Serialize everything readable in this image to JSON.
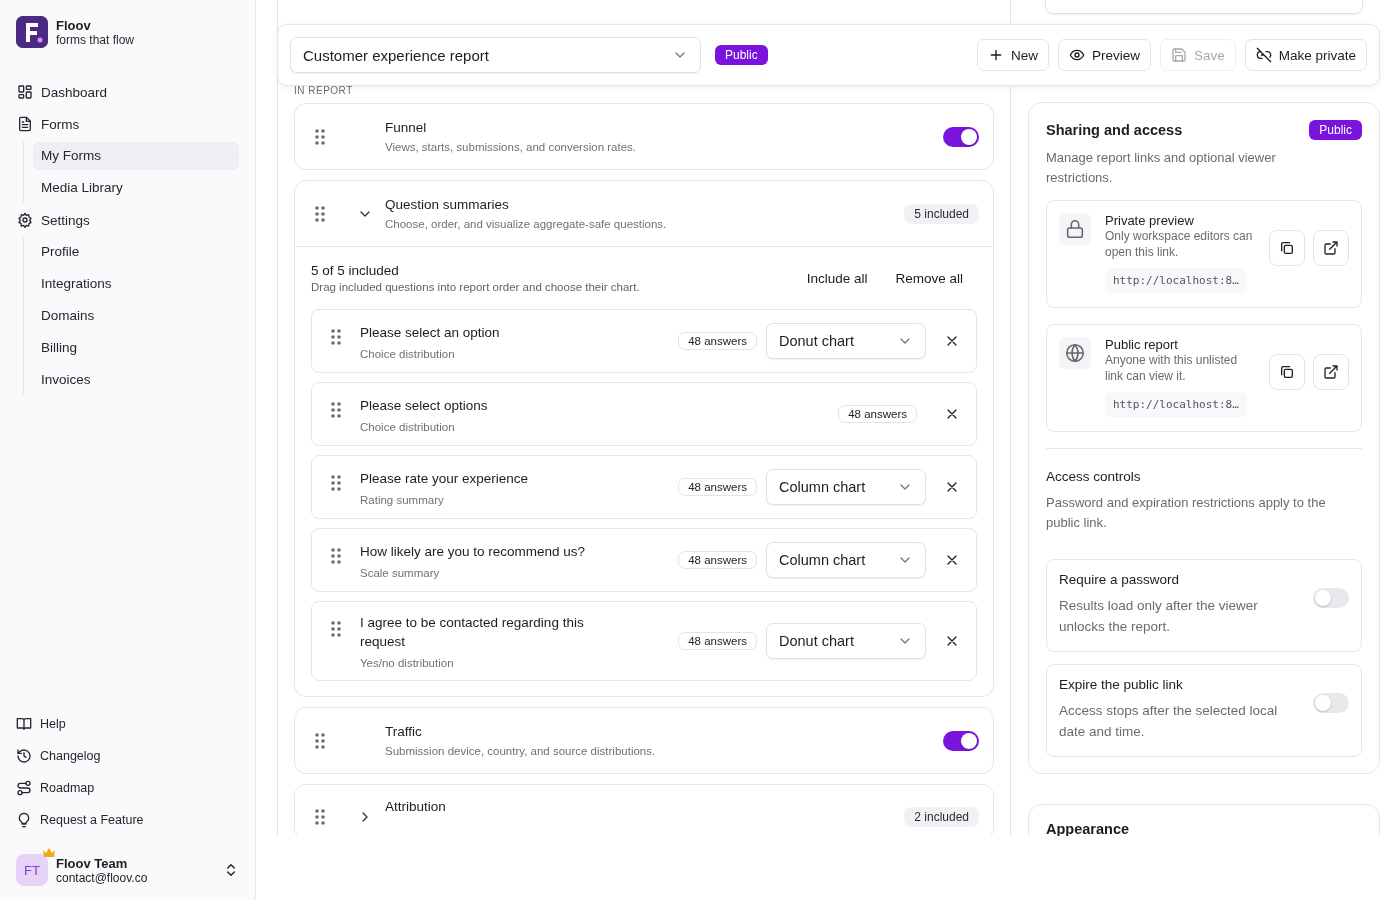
{
  "sidebar": {
    "brand": {
      "name": "Floov",
      "tagline": "forms that flow"
    },
    "nav": [
      {
        "label": "Dashboard",
        "selected": false
      },
      {
        "label": "Forms",
        "selected": false,
        "children": [
          {
            "label": "My Forms",
            "selected": true
          },
          {
            "label": "Media Library",
            "selected": false
          }
        ]
      },
      {
        "label": "Settings",
        "selected": false,
        "children": [
          {
            "label": "Profile",
            "selected": false
          },
          {
            "label": "Integrations",
            "selected": false
          },
          {
            "label": "Domains",
            "selected": false
          },
          {
            "label": "Billing",
            "selected": false
          },
          {
            "label": "Invoices",
            "selected": false
          }
        ]
      }
    ],
    "footer_links": [
      "Help",
      "Changelog",
      "Roadmap",
      "Request a Feature"
    ],
    "user": {
      "initials": "FT",
      "name": "Floov Team",
      "email": "contact@floov.co"
    }
  },
  "toolbar": {
    "report_select": "Customer experience report",
    "visibility_badge": "Public",
    "buttons": [
      {
        "label": "New",
        "disabled": false
      },
      {
        "label": "Preview",
        "disabled": false
      },
      {
        "label": "Save",
        "disabled": true
      },
      {
        "label": "Make private",
        "disabled": false
      }
    ]
  },
  "report": {
    "label": "IN REPORT",
    "sections": [
      {
        "kind": "toggle",
        "title": "Funnel",
        "description": "Views, starts, submissions, and conversion rates.",
        "on": true
      },
      {
        "kind": "group",
        "title": "Question summaries",
        "description": "Choose, order, and visualize aggregate-safe questions.",
        "badge": "5 included",
        "expanded": true,
        "summary": "5 of 5 included",
        "hint": "Drag included questions into report order and choose their chart.",
        "actions": [
          "Include all",
          "Remove all"
        ],
        "questions": [
          {
            "title": "Please select an option",
            "subtitle": "Choice distribution",
            "answers": "48 answers",
            "chart": "Donut chart"
          },
          {
            "title": "Please select options",
            "subtitle": "Choice distribution",
            "answers": "48 answers"
          },
          {
            "title": "Please rate your experience",
            "subtitle": "Rating summary",
            "answers": "48 answers",
            "chart": "Column chart"
          },
          {
            "title": "How likely are you to recommend us?",
            "subtitle": "Scale summary",
            "answers": "48 answers",
            "chart": "Column chart"
          },
          {
            "title": "I agree to be contacted regarding this request",
            "subtitle": "Yes/no distribution",
            "answers": "48 answers",
            "chart": "Donut chart"
          }
        ]
      },
      {
        "kind": "toggle",
        "title": "Traffic",
        "description": "Submission device, country, and source distributions.",
        "on": true
      },
      {
        "kind": "group",
        "title": "Attribution",
        "badge": "2 included",
        "expanded": false
      }
    ]
  },
  "sharing": {
    "title": "Sharing and access",
    "badge": "Public",
    "description": "Manage report links and optional viewer restrictions.",
    "links": [
      {
        "kind": "private",
        "title": "Private preview",
        "description": "Only workspace editors can open this link.",
        "url": "http://localhost:8…"
      },
      {
        "kind": "public",
        "title": "Public report",
        "description": "Anyone with this unlisted link can view it.",
        "url": "http://localhost:8…"
      }
    ],
    "access": {
      "title": "Access controls",
      "description": "Password and expiration restrictions apply to the public link.",
      "options": [
        {
          "title": "Require a password",
          "description": "Results load only after the viewer unlocks the report.",
          "on": false
        },
        {
          "title": "Expire the public link",
          "description": "Access stops after the selected local date and time.",
          "on": false
        }
      ]
    }
  },
  "appearance": {
    "title": "Appearance"
  }
}
